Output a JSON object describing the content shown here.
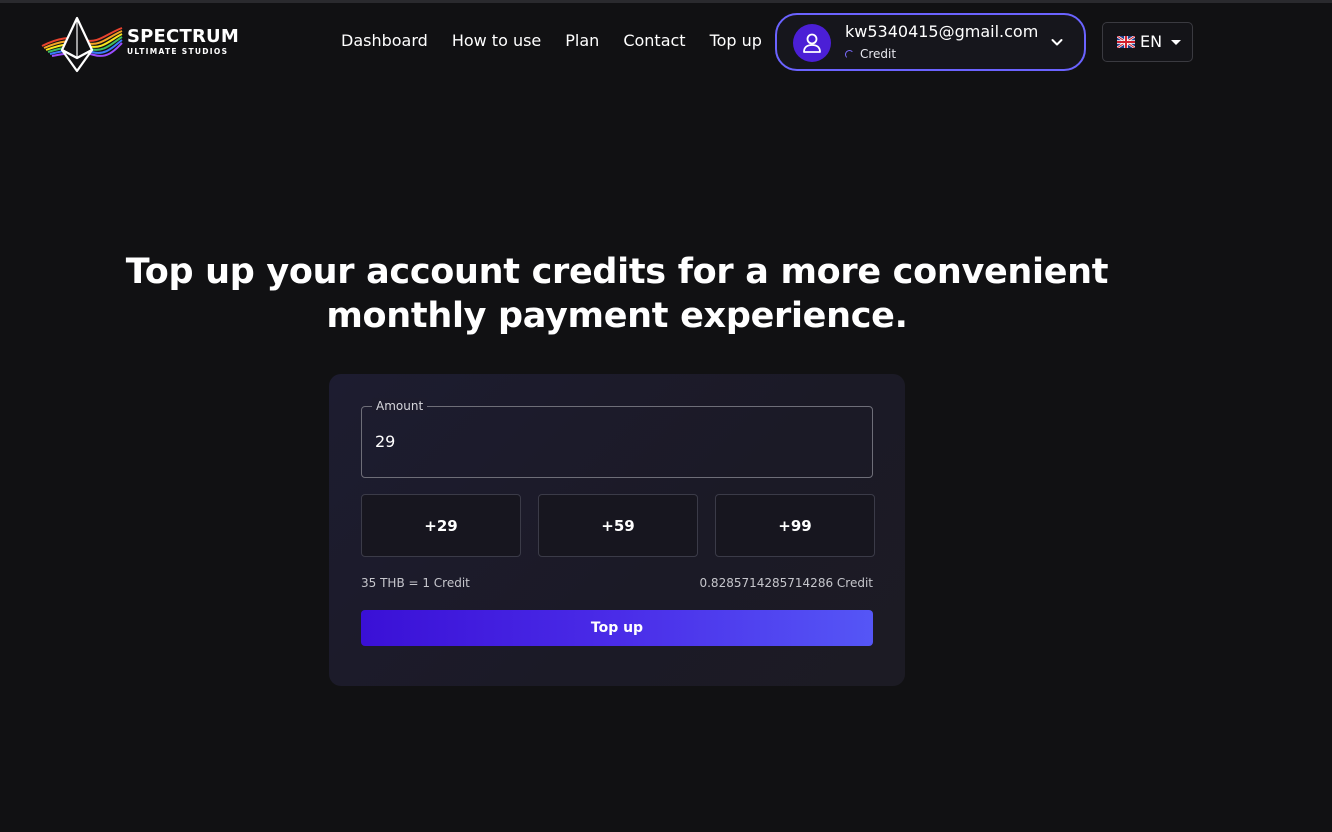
{
  "brand": {
    "title": "SPECTRUM",
    "subtitle": "ULTIMATE STUDIOS"
  },
  "nav": {
    "items": [
      {
        "label": "Dashboard"
      },
      {
        "label": "How to use"
      },
      {
        "label": "Plan"
      },
      {
        "label": "Contact"
      },
      {
        "label": "Top up"
      }
    ]
  },
  "account": {
    "email": "kw5340415@gmail.com",
    "credit_label": "Credit",
    "accent_color": "#6b63ff"
  },
  "language": {
    "code": "EN",
    "flag_icon": "uk-flag-icon"
  },
  "headline": "Top up your account credits for a more convenient monthly payment experience.",
  "topup": {
    "amount_label": "Amount",
    "amount_value": "29",
    "presets": [
      "+29",
      "+59",
      "+99"
    ],
    "rate_text": "35 THB = 1 Credit",
    "credit_result": "0.8285714285714286 Credit",
    "button_label": "Top up",
    "button_gradient": [
      "#3a10d6",
      "#5556f6"
    ]
  }
}
